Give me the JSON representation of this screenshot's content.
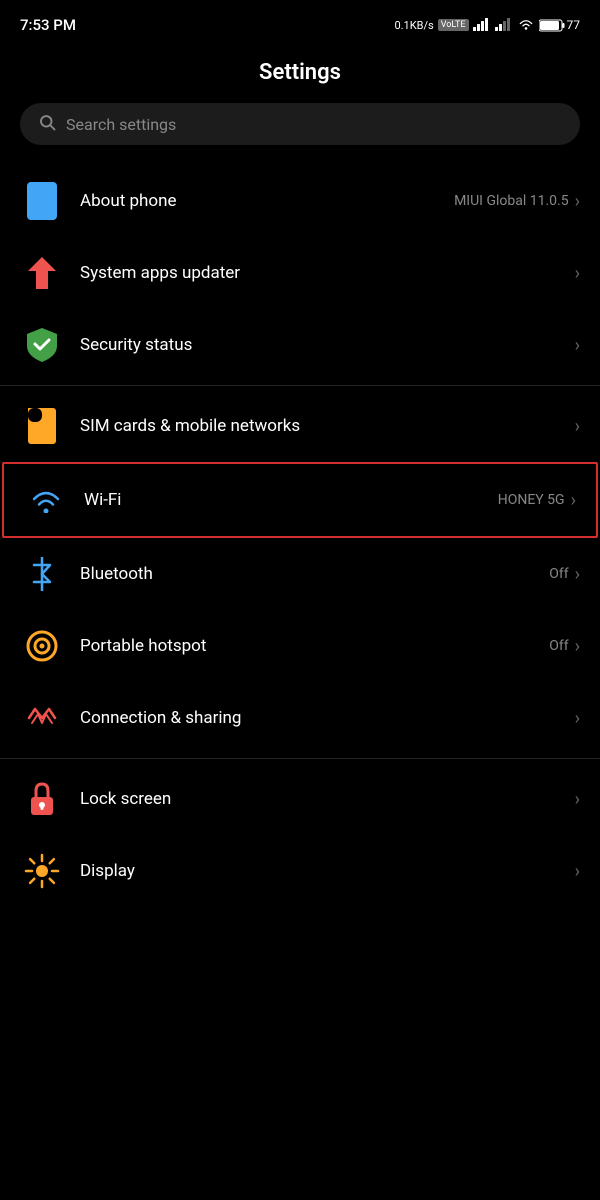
{
  "statusBar": {
    "time": "7:53 PM",
    "network": "0.1KB/s",
    "networkType": "VoLTE",
    "battery": "77"
  },
  "page": {
    "title": "Settings"
  },
  "search": {
    "placeholder": "Search settings"
  },
  "items": [
    {
      "id": "about-phone",
      "label": "About phone",
      "valueText": "MIUI Global 11.0.5",
      "hasChevron": true,
      "iconType": "phone",
      "highlighted": false
    },
    {
      "id": "system-apps-updater",
      "label": "System apps updater",
      "valueText": "",
      "hasChevron": true,
      "iconType": "arrow-up",
      "highlighted": false
    },
    {
      "id": "security-status",
      "label": "Security status",
      "valueText": "",
      "hasChevron": true,
      "iconType": "shield",
      "highlighted": false
    },
    {
      "id": "sim-cards",
      "label": "SIM cards & mobile networks",
      "valueText": "",
      "hasChevron": true,
      "iconType": "sim",
      "highlighted": false,
      "dividerBefore": true
    },
    {
      "id": "wifi",
      "label": "Wi-Fi",
      "valueText": "HONEY 5G",
      "hasChevron": true,
      "iconType": "wifi",
      "highlighted": true
    },
    {
      "id": "bluetooth",
      "label": "Bluetooth",
      "valueText": "Off",
      "hasChevron": true,
      "iconType": "bluetooth",
      "highlighted": false
    },
    {
      "id": "portable-hotspot",
      "label": "Portable hotspot",
      "valueText": "Off",
      "hasChevron": true,
      "iconType": "hotspot",
      "highlighted": false
    },
    {
      "id": "connection-sharing",
      "label": "Connection & sharing",
      "valueText": "",
      "hasChevron": true,
      "iconType": "connection",
      "highlighted": false
    },
    {
      "id": "lock-screen",
      "label": "Lock screen",
      "valueText": "",
      "hasChevron": true,
      "iconType": "lock",
      "highlighted": false,
      "dividerBefore": true
    },
    {
      "id": "display",
      "label": "Display",
      "valueText": "",
      "hasChevron": true,
      "iconType": "display",
      "highlighted": false
    }
  ],
  "icons": {
    "chevron": "›",
    "search": "🔍"
  }
}
